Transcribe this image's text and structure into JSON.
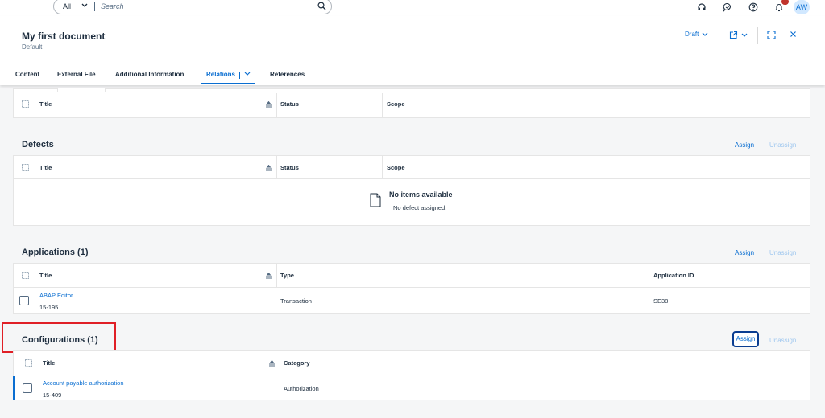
{
  "shell": {
    "search_scope": "All",
    "search_placeholder": "Search",
    "notification_count": "",
    "avatar_initials": "AW"
  },
  "header": {
    "title": "My first document",
    "subtitle": "Default",
    "draft_label": "Draft"
  },
  "tabs": [
    {
      "label": "Content"
    },
    {
      "label": "External File"
    },
    {
      "label": "Additional Information"
    },
    {
      "label": "Relations"
    },
    {
      "label": "References"
    }
  ],
  "top_table": {
    "columns": [
      "Title",
      "Status",
      "Scope"
    ]
  },
  "defects": {
    "title": "Defects",
    "assign": "Assign",
    "unassign": "Unassign",
    "columns": [
      "Title",
      "Status",
      "Scope"
    ],
    "empty_title": "No items available",
    "empty_text": "No defect assigned."
  },
  "applications": {
    "title": "Applications (1)",
    "assign": "Assign",
    "unassign": "Unassign",
    "columns": [
      "Title",
      "Type",
      "Application ID"
    ],
    "rows": [
      {
        "title": "ABAP Editor",
        "id": "15-195",
        "type": "Transaction",
        "app_id": "SE38"
      }
    ]
  },
  "configurations": {
    "title": "Configurations (1)",
    "assign": "Assign",
    "unassign": "Unassign",
    "columns": [
      "Title",
      "Category"
    ],
    "rows": [
      {
        "title": "Account payable authorization",
        "id": "15-409",
        "category": "Authorization"
      }
    ]
  },
  "colors": {
    "accent": "#0a6ed1",
    "highlight": "#e01f26",
    "text": "#1d2d3e"
  }
}
